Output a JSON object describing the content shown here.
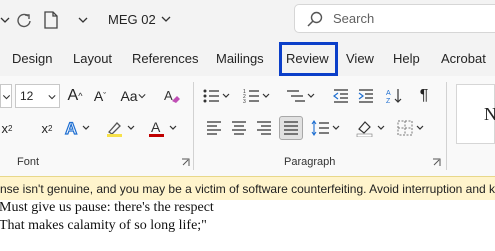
{
  "title_bar": {
    "document_name": "MEG 02",
    "search_placeholder": "Search"
  },
  "tabs": [
    {
      "label": "Design"
    },
    {
      "label": "Layout"
    },
    {
      "label": "References"
    },
    {
      "label": "Mailings"
    },
    {
      "label": "Review"
    },
    {
      "label": "View"
    },
    {
      "label": "Help"
    },
    {
      "label": "Acrobat"
    }
  ],
  "ribbon": {
    "font_size_value": "12",
    "font_group_label": "Font",
    "paragraph_group_label": "Paragraph",
    "style_preview": "N"
  },
  "banner": {
    "text": "nse isn't genuine, and you may be a victim of software counterfeiting. Avoid interruption and k"
  },
  "document": {
    "lines": [
      "Must give us pause: there's the respect",
      "That makes calamity of so long life;\""
    ]
  },
  "colors": {
    "highlight_box": "#0b3fc9",
    "banner_bg": "#fff4cc",
    "font_color_accent": "#c00000",
    "text_effects_accent": "#1f6fd1"
  }
}
